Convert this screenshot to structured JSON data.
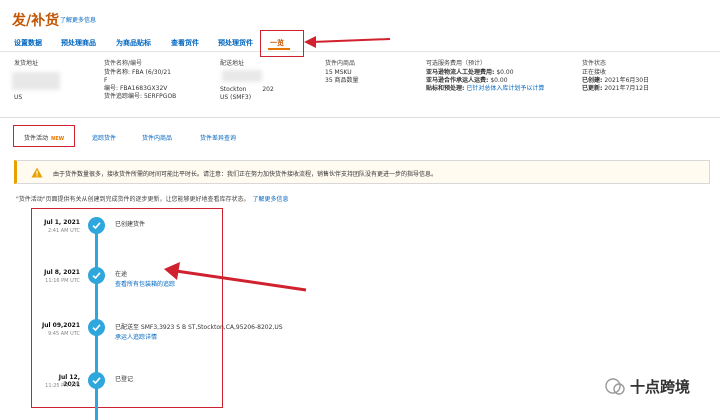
{
  "header": {
    "title": "发/补货",
    "learn_more": "了解更多信息"
  },
  "nav": {
    "tabs": [
      "设置数据",
      "预处理商品",
      "为商品贴标",
      "查看货件",
      "预处理货件",
      "一览"
    ],
    "active_index": 5
  },
  "info": {
    "origin": {
      "header": "发货地址",
      "country": "US"
    },
    "shipment": {
      "header": "货件名称/编号",
      "name_label": "货件名称:",
      "name_value": "FBA (6/30/21",
      "id_label": "编号:",
      "id_value": "FBA1683GX32V",
      "tracking_label": "货件追踪编号:",
      "tracking_value": "5ERFPGOB"
    },
    "destination": {
      "header": "配送地址",
      "city": "Stockton",
      "center": "US (SMF3)",
      "zip": "202"
    },
    "contents": {
      "header": "货件内商品",
      "msku": "15 MSKU",
      "units": "35 商品数量"
    },
    "fees": {
      "header": "可选服务费用（预计）",
      "row1_label": "亚马逊物流人工处理费用:",
      "row1_value": "$0.00",
      "row2_label": "亚马逊合作承运人运费:",
      "row2_value": "$0.00",
      "row3_label": "贴标和预处理:",
      "row3_link": "已针对总体入库计划予以计算"
    },
    "status": {
      "header": "货件状态",
      "value": "正在接收",
      "created_label": "已创建:",
      "created": "2021年6月30日",
      "updated_label": "已更新:",
      "updated": "2021年7月12日"
    }
  },
  "sub_tabs": {
    "items": [
      "货件活动",
      "追踪货件",
      "货件内商品",
      "货件差异查询"
    ],
    "new_badge": "NEW"
  },
  "alert": {
    "text": "由于货件数量很多，接收货件所需的时间可能比平时长。请注意：我们正在努力加快货件接收流程，销售伙伴支持团队没有更进一步的指导信息。"
  },
  "description": {
    "text": "\"货件活动\"页面提供有关从创建到完成货件的逐步更新，让您能够更好地查看库存状态。",
    "link": "了解更多信息"
  },
  "timeline": [
    {
      "date": "Jul 1, 2021",
      "time": "2:41 AM UTC",
      "title": "已创建货件",
      "link": ""
    },
    {
      "date": "Jul 8, 2021",
      "time": "11:16 PM UTC",
      "title": "在途",
      "link": "查看所有包装箱的追踪"
    },
    {
      "date": "Jul 09,2021",
      "time": "9:45 AM UTC",
      "title": "已配送至 SMF3,3923 S B ST,Stockton,CA,95206-8202,US",
      "link": "承运人追踪详情"
    },
    {
      "date": "Jul 12, 2021",
      "time": "11:25 PM UTC",
      "title": "已登记",
      "link": ""
    }
  ],
  "watermark": {
    "text": "十点跨境"
  },
  "colors": {
    "accent": "#c45500",
    "link": "#0066c0",
    "timeline": "#2fa6dc",
    "annotation": "#d0212e"
  }
}
